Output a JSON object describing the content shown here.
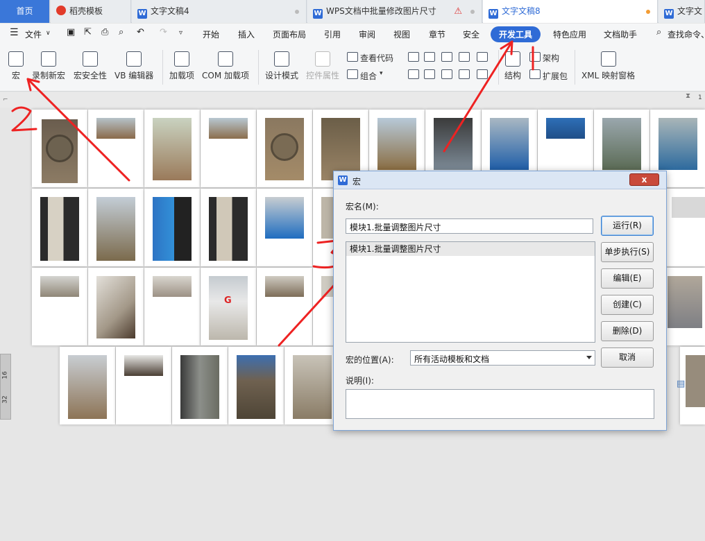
{
  "tabs": [
    {
      "label": "首页"
    },
    {
      "label": "稻壳模板"
    },
    {
      "label": "文字文稿4"
    },
    {
      "label": "WPS文档中批量修改图片尺寸"
    },
    {
      "label": "文字文稿8"
    },
    {
      "label": "文字文"
    }
  ],
  "menu": {
    "file": "文件",
    "items": [
      "开始",
      "插入",
      "页面布局",
      "引用",
      "审阅",
      "视图",
      "章节",
      "安全",
      "开发工具",
      "特色应用",
      "文档助手"
    ],
    "search": "查找命令、"
  },
  "ribbon": {
    "macro": "宏",
    "record": "录制新宏",
    "security": "宏安全性",
    "vb": "VB 编辑器",
    "addins": "加载项",
    "com": "COM 加载项",
    "design": "设计模式",
    "ctrlprop": "控件属性",
    "viewcode": "查看代码",
    "group": "组合",
    "structure": "结构",
    "schema": "架构",
    "expansion": "扩展包",
    "xml": "XML 映射窗格"
  },
  "ruler": {
    "v1": "16",
    "v2": "32",
    "right": "1"
  },
  "dialog": {
    "title": "宏",
    "name_label": "宏名(M):",
    "name_value": "模块1.批量调整图片尺寸",
    "list": [
      "模块1.批量调整图片尺寸"
    ],
    "location_label": "宏的位置(A):",
    "location_value": "所有活动模板和文档",
    "desc_label": "说明(I):",
    "close": "x",
    "buttons": {
      "run": "运行(R)",
      "step": "单步执行(S)",
      "edit": "编辑(E)",
      "create": "创建(C)",
      "delete": "删除(D)",
      "cancel": "取消"
    }
  },
  "colors": {
    "accent": "#2f6bd6",
    "annotation": "#ee2222"
  }
}
